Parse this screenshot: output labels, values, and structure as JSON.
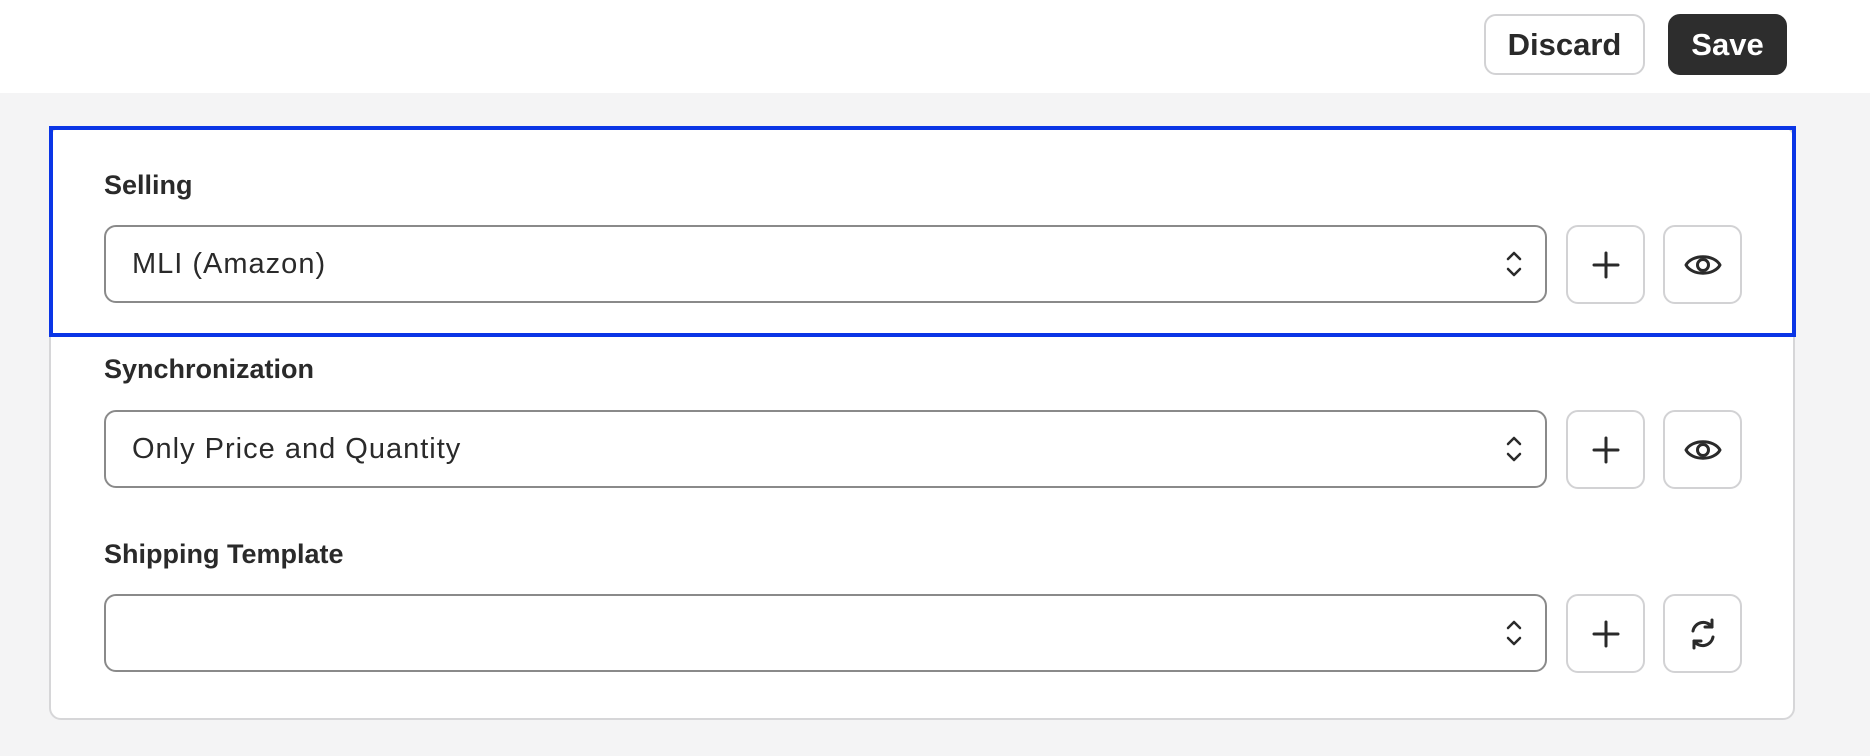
{
  "toolbar": {
    "discard_label": "Discard",
    "save_label": "Save"
  },
  "fields": [
    {
      "label": "Selling",
      "value": "MLI (Amazon)",
      "actions": [
        "plus-icon",
        "eye-icon"
      ]
    },
    {
      "label": "Synchronization",
      "value": "Only Price and Quantity",
      "actions": [
        "plus-icon",
        "eye-icon"
      ]
    },
    {
      "label": "Shipping Template",
      "value": "",
      "actions": [
        "plus-icon",
        "refresh-icon"
      ]
    }
  ],
  "colors": {
    "focus": "#0a35e6",
    "primary_button": "#2d2d2d",
    "page_background": "#f4f4f5"
  }
}
